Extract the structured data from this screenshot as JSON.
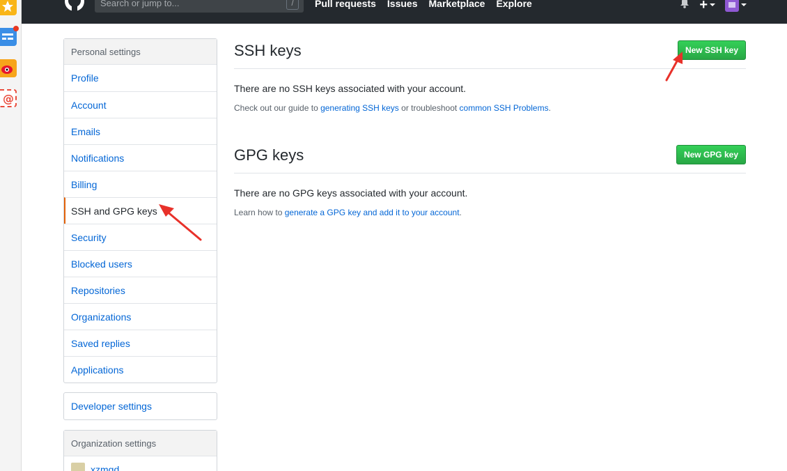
{
  "header": {
    "search_placeholder": "Search or jump to...",
    "search_key": "/",
    "nav": [
      "Pull requests",
      "Issues",
      "Marketplace",
      "Explore"
    ],
    "plus": "+"
  },
  "sidebar": {
    "personal_heading": "Personal settings",
    "items": [
      {
        "label": "Profile"
      },
      {
        "label": "Account"
      },
      {
        "label": "Emails"
      },
      {
        "label": "Notifications"
      },
      {
        "label": "Billing"
      },
      {
        "label": "SSH and GPG keys",
        "selected": true
      },
      {
        "label": "Security"
      },
      {
        "label": "Blocked users"
      },
      {
        "label": "Repositories"
      },
      {
        "label": "Organizations"
      },
      {
        "label": "Saved replies"
      },
      {
        "label": "Applications"
      }
    ],
    "developer_settings": "Developer settings",
    "org_heading": "Organization settings",
    "org_name": "xzmgd"
  },
  "ssh": {
    "title": "SSH keys",
    "button": "New SSH key",
    "empty": "There are no SSH keys associated with your account.",
    "help_prefix": "Check out our guide to ",
    "help_link1": "generating SSH keys",
    "help_middle": " or troubleshoot ",
    "help_link2": "common SSH Problems",
    "help_suffix": "."
  },
  "gpg": {
    "title": "GPG keys",
    "button": "New GPG key",
    "empty": "There are no GPG keys associated with your account.",
    "help_prefix": "Learn how to ",
    "help_link": "generate a GPG key and add it to your account",
    "help_suffix": "."
  },
  "colors": {
    "header_bg": "#24292e",
    "link": "#0366d6",
    "selected_border": "#e36209",
    "button_green": "#28a745",
    "annotation_arrow": "#e8312a"
  }
}
